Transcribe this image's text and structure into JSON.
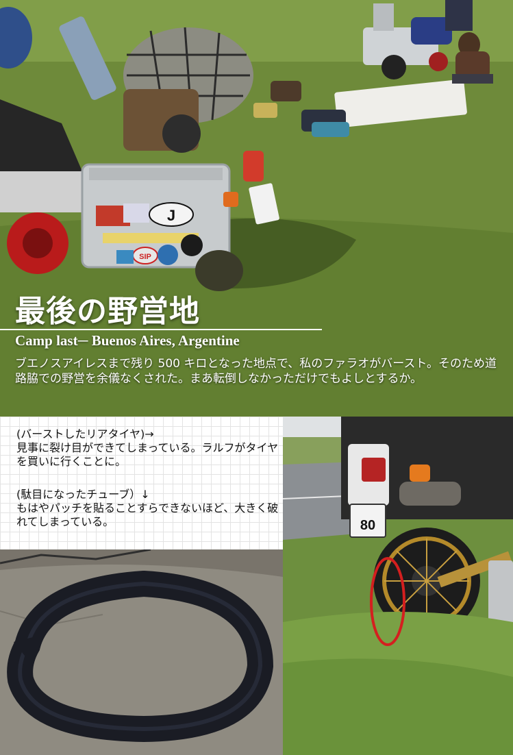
{
  "article": {
    "title": "最後の野営地",
    "subtitle": "Camp last─ Buenos Aires, Argentine",
    "lead": "ブエノスアイレスまで残り 500 キロとなった地点で、私のファラオがバースト。そのため道路脇での野営を余儀なくされた。まあ転倒しなかっただけでもよしとするか。"
  },
  "captions": {
    "rear_tire_label": "(バーストしたリアタイヤ)→",
    "rear_tire_text": "見事に裂け目ができてしまっている。ラルフがタイヤを買いに行くことに。",
    "tube_text": "(駄目になったチューブ）↓\nもはやパッチを貼ることすらできないほど、大きく破れてしまっている。"
  },
  "photo_text": {
    "country_sticker": "J",
    "sticker_sip": "SIP",
    "plate": "80"
  },
  "colors": {
    "grass": "#6f8c3a",
    "highlight_circle": "#d41f1f",
    "title_text": "#ffffff"
  }
}
